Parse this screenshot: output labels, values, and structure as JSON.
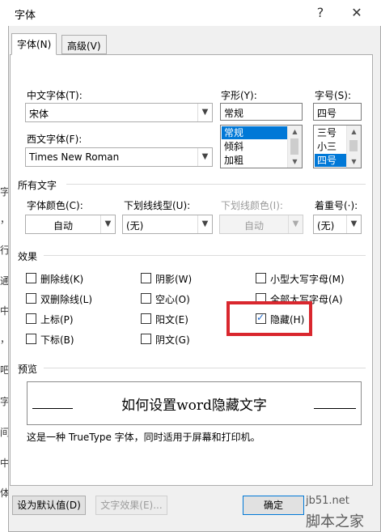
{
  "dialog": {
    "title": "字体",
    "help": "?",
    "close": "✕"
  },
  "tabs": [
    {
      "label": "字体(N)"
    },
    {
      "label": "高级(V)"
    }
  ],
  "font": {
    "chinese_label": "中文字体(T):",
    "chinese_value": "宋体",
    "western_label": "西文字体(F):",
    "western_value": "Times New Roman",
    "style_label": "字形(Y):",
    "style_value": "常规",
    "style_options": [
      "常规",
      "倾斜",
      "加粗"
    ],
    "size_label": "字号(S):",
    "size_value": "四号",
    "size_options": [
      "三号",
      "小三",
      "四号"
    ]
  },
  "all_text": {
    "section": "所有文字",
    "color_label": "字体颜色(C):",
    "color_value": "自动",
    "underline_label": "下划线线型(U):",
    "underline_value": "(无)",
    "underline_color_label": "下划线颜色(I):",
    "underline_color_value": "自动",
    "emphasis_label": "着重号(·):",
    "emphasis_value": "(无)"
  },
  "effects": {
    "section": "效果",
    "items": [
      {
        "label": "删除线(K)",
        "checked": false
      },
      {
        "label": "双删除线(L)",
        "checked": false
      },
      {
        "label": "上标(P)",
        "checked": false
      },
      {
        "label": "下标(B)",
        "checked": false
      },
      {
        "label": "阴影(W)",
        "checked": false
      },
      {
        "label": "空心(O)",
        "checked": false
      },
      {
        "label": "阳文(E)",
        "checked": false
      },
      {
        "label": "阴文(G)",
        "checked": false
      },
      {
        "label": "小型大写字母(M)",
        "checked": false
      },
      {
        "label": "全部大写字母(A)",
        "checked": false
      },
      {
        "label": "隐藏(H)",
        "checked": true
      }
    ]
  },
  "preview": {
    "section": "预览",
    "text": "如何设置word隐藏文字",
    "note": "这是一种 TrueType 字体，同时适用于屏幕和打印机。"
  },
  "buttons": {
    "default": "设为默认值(D)",
    "effects": "文字效果(E)...",
    "ok": "确定"
  },
  "watermark": {
    "site": "jb51.net",
    "brand": "脚本之家"
  },
  "background_chars": [
    "字",
    "，",
    "行",
    "通",
    "中",
    "，",
    "吧",
    "字",
    "间",
    "中",
    "体"
  ],
  "colors": {
    "highlight": "#d9272e",
    "selection": "#0078d7"
  }
}
